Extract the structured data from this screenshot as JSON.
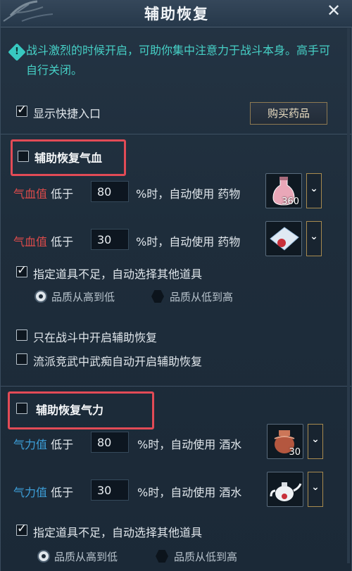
{
  "window": {
    "title": "辅助恢复"
  },
  "info": {
    "text": "战斗激烈的时候开启，可助你集中注意力于战斗本身。高手可自行关闭。"
  },
  "shortcut": {
    "label": "显示快捷入口",
    "checked": true
  },
  "buy_button": {
    "label": "购买药品"
  },
  "hp": {
    "title": "辅助恢复气血",
    "rows": [
      {
        "stat": "气血值",
        "below": "低于",
        "value": "80",
        "suffix": "%时，自动使用 药物",
        "item_qty": "360"
      },
      {
        "stat": "气血值",
        "below": "低于",
        "value": "30",
        "suffix": "%时，自动使用 药物",
        "item_qty": ""
      }
    ],
    "auto_select_label": "指定道具不足，自动选择其他道具",
    "quality_high_label": "品质从高到低",
    "quality_low_label": "品质从低到高",
    "combat_only_label": "只在战斗中开启辅助恢复",
    "pvp_label": "流派竞武中武痴自动开启辅助恢复"
  },
  "mp": {
    "title": "辅助恢复气力",
    "rows": [
      {
        "stat": "气力值",
        "below": "低于",
        "value": "80",
        "suffix": "%时，自动使用 酒水",
        "item_qty": "30"
      },
      {
        "stat": "气力值",
        "below": "低于",
        "value": "30",
        "suffix": "%时，自动使用 酒水",
        "item_qty": ""
      }
    ],
    "auto_select_label": "指定道具不足，自动选择其他道具",
    "quality_high_label": "品质从高到低",
    "quality_low_label": "品质从低到高"
  }
}
